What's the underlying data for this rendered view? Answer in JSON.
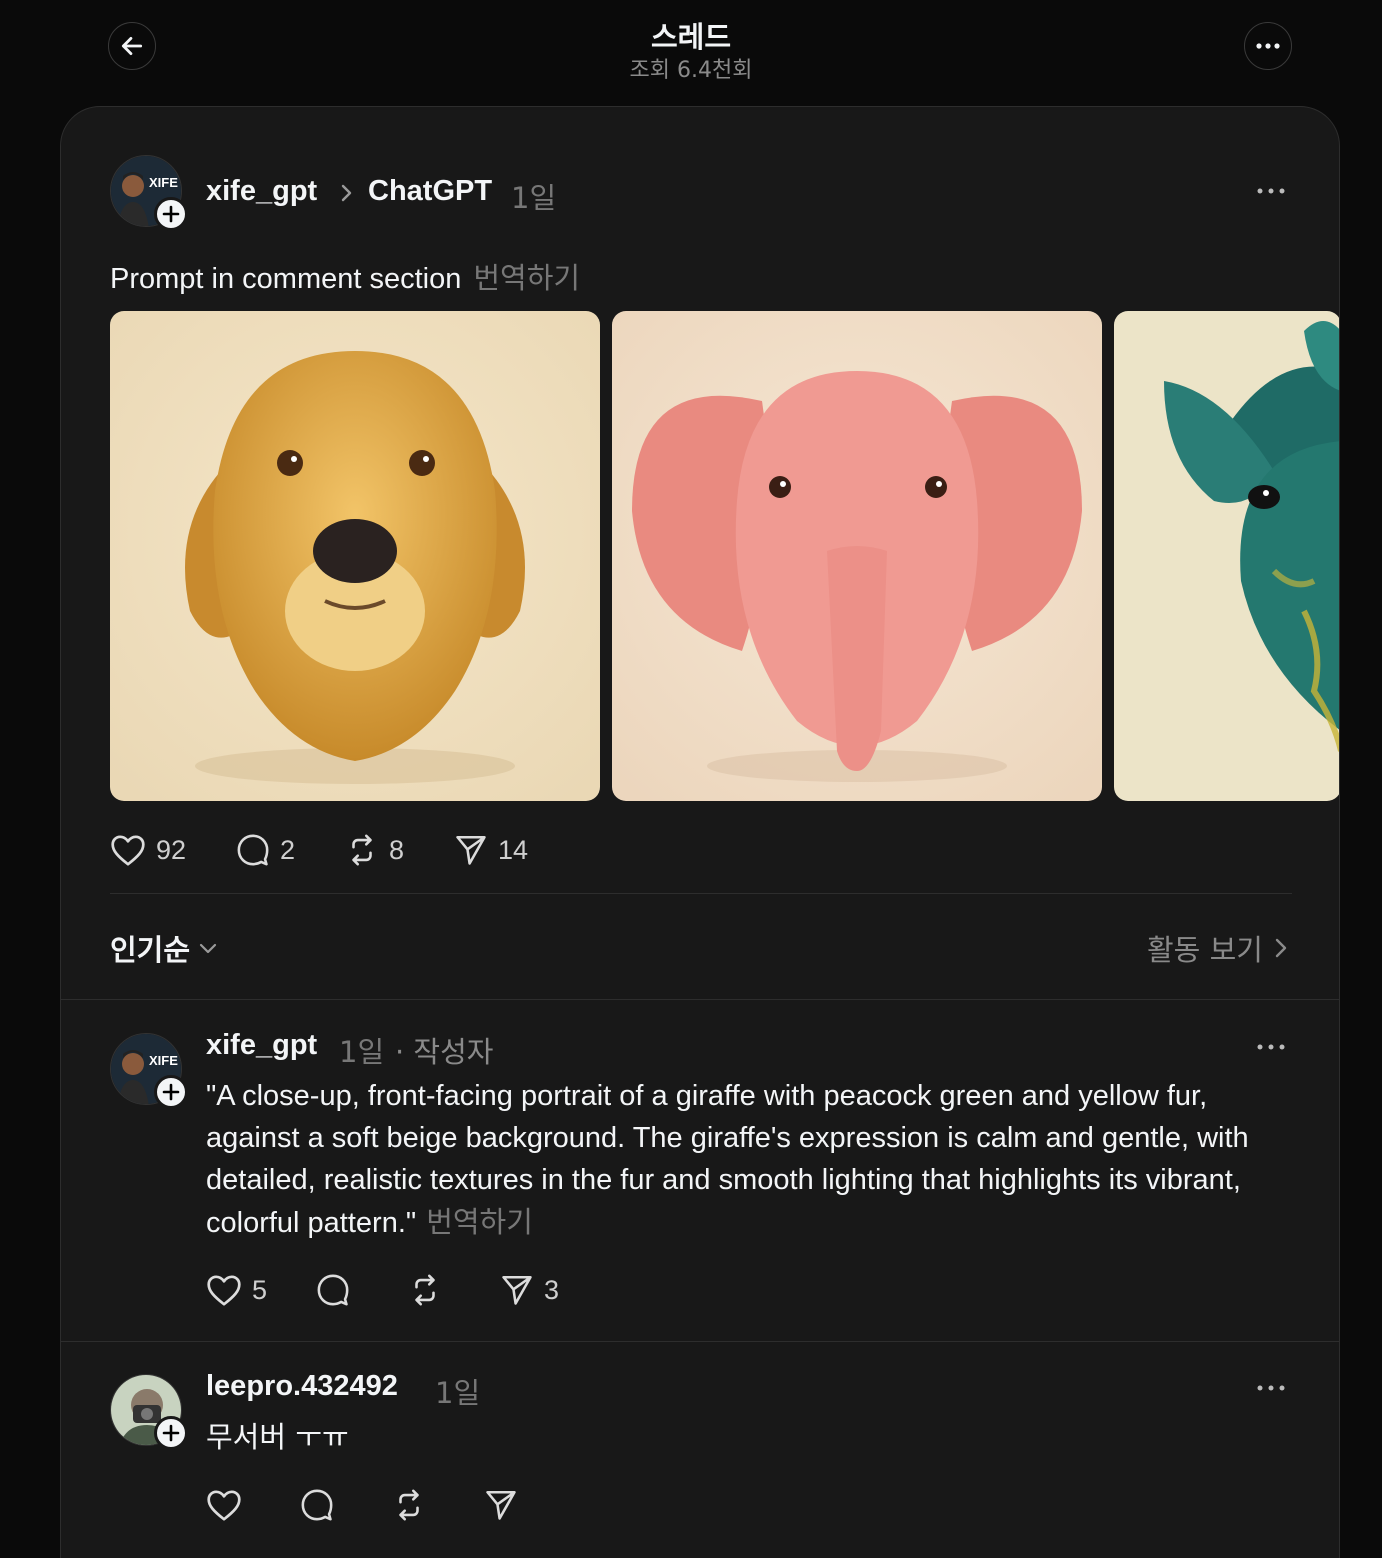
{
  "header": {
    "title": "스레드",
    "subtitle": "조회 6.4천회"
  },
  "post": {
    "username": "xife_gpt",
    "community": "ChatGPT",
    "time": "1일",
    "text": "Prompt in comment section",
    "translate": "번역하기",
    "avatar_text": "XIFE GPT",
    "images": [
      "golden-retriever-portrait",
      "pink-elephant-portrait",
      "teal-giraffe-portrait"
    ],
    "likes": "92",
    "comments": "2",
    "reposts": "8",
    "shares": "14"
  },
  "sort": {
    "label": "인기순",
    "activity": "활동 보기"
  },
  "comments": [
    {
      "username": "xife_gpt",
      "time": "1일",
      "badge": "· 작성자",
      "text": "\"A close-up, front-facing portrait of a giraffe with peacock green and yellow fur, against a soft beige background. The giraffe's expression is calm and gentle, with detailed, realistic textures in the fur and smooth lighting that highlights its vibrant, colorful pattern.\"",
      "translate": "번역하기",
      "likes": "5",
      "comments": "",
      "reposts": "",
      "shares": "3"
    },
    {
      "username": "leepro.432492",
      "time": "1일",
      "text": "무서버 ㅜㅠ",
      "likes": "",
      "comments": "",
      "reposts": "",
      "shares": ""
    }
  ],
  "colors": {
    "background": "#0a0a0a",
    "card": "#181818",
    "text": "#f3f5f7",
    "muted": "#777777"
  }
}
